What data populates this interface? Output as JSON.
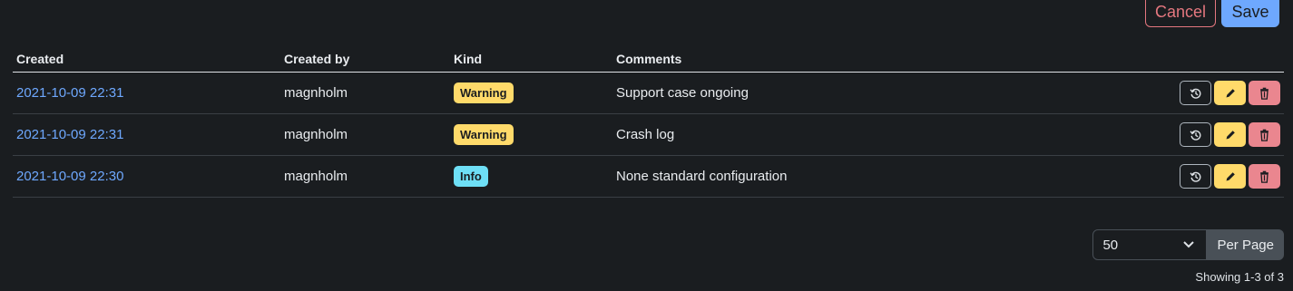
{
  "toolbar": {
    "cancel_label": "Cancel",
    "save_label": "Save"
  },
  "table": {
    "headers": {
      "created": "Created",
      "created_by": "Created by",
      "kind": "Kind",
      "comments": "Comments"
    },
    "rows": [
      {
        "created": "2021-10-09 22:31",
        "created_by": "magnholm",
        "kind": "Warning",
        "comment": "Support case ongoing"
      },
      {
        "created": "2021-10-09 22:31",
        "created_by": "magnholm",
        "kind": "Warning",
        "comment": "Crash log"
      },
      {
        "created": "2021-10-09 22:30",
        "created_by": "magnholm",
        "kind": "Info",
        "comment": "None standard configuration"
      }
    ]
  },
  "row_action_icons": [
    "history-icon",
    "pencil-icon",
    "trash-icon"
  ],
  "badge_colors": {
    "Warning": "#ffda6a",
    "Info": "#6edff6"
  },
  "pagination": {
    "per_page_value": "50",
    "per_page_label": "Per Page",
    "showing_text": "Showing 1-3 of 3"
  }
}
